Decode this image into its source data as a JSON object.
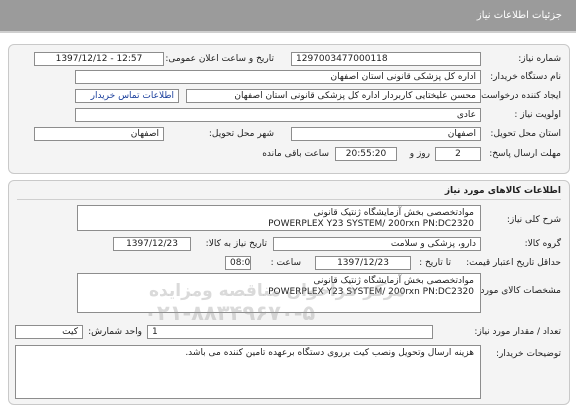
{
  "header": {
    "title": "جزئیات اطلاعات نیاز"
  },
  "need_info": {
    "need_number_label": "شماره نیاز:",
    "need_number": "1297003477000118",
    "announce_label": "تاریخ و ساعت اعلان عمومی:",
    "announce_value": "1397/12/12 - 12:57",
    "buyer_label": "نام دستگاه خریدار:",
    "buyer_value": "اداره کل پزشکی قانونی استان اصفهان",
    "creator_label": "ایجاد کننده درخواست:",
    "creator_value": "محسن علیختایی کاربردار اداره کل پزشکی قانونی استان اصفهان",
    "contact_link": "اطلاعات تماس خریدار",
    "priority_label": "اولویت نیاز :",
    "priority_value": "عادی",
    "province_label": "استان محل تحویل:",
    "province_value": "اصفهان",
    "city_label": "شهر محل تحویل:",
    "city_value": "اصفهان",
    "deadline_label": "مهلت ارسال پاسخ:",
    "deadline_days": "2",
    "days_word": "روز و",
    "deadline_time": "20:55:20",
    "remaining_label": "ساعت باقی مانده"
  },
  "goods": {
    "section_title": "اطلاعات کالاهای مورد نیاز",
    "summary_label": "شرح کلی نیاز:",
    "summary_line1": "موادتخصصی بخش آزمایشگاه ژنتیک قانونی",
    "summary_line2": "POWERPLEX Y23 SYSTEM/ 200rxn  PN:DC2320",
    "group_label": "گروه کالا:",
    "group_value": "دارو، پزشکی و سلامت",
    "need_date_label": "تاریخ نیاز به کالا:",
    "need_date_value": "1397/12/23",
    "min_price_label": "حداقل تاریخ اعتبار قیمت:",
    "min_price_date": "1397/12/23",
    "to_date_label": "تا تاریخ :",
    "hour_label": "ساعت :",
    "hour_value": "08:00",
    "spec_label": "مشخصات کالای مورد نیاز:",
    "spec_line1": "موادتخصصی بخش آزمایشگاه ژنتیک قانونی",
    "spec_line2": "POWERPLEX Y23 SYSTEM/ 200rxn  PN:DC2320",
    "qty_label": "تعداد / مقدار مورد نیاز:",
    "qty_value": "1",
    "unit_label": "واحد شمارش:",
    "unit_value": "کیت",
    "notes_label": "توضیحات خریدار:",
    "notes_value": "هزینه ارسال وتحویل ونصب کیت برروی دستگاه برعهده تامین کننده می باشد.",
    "watermark1": "مرکز فراخوان مناقصه ومزایده",
    "watermark2": "۰۲۱-۸۸۳۴۹۶۷۰-۵"
  }
}
